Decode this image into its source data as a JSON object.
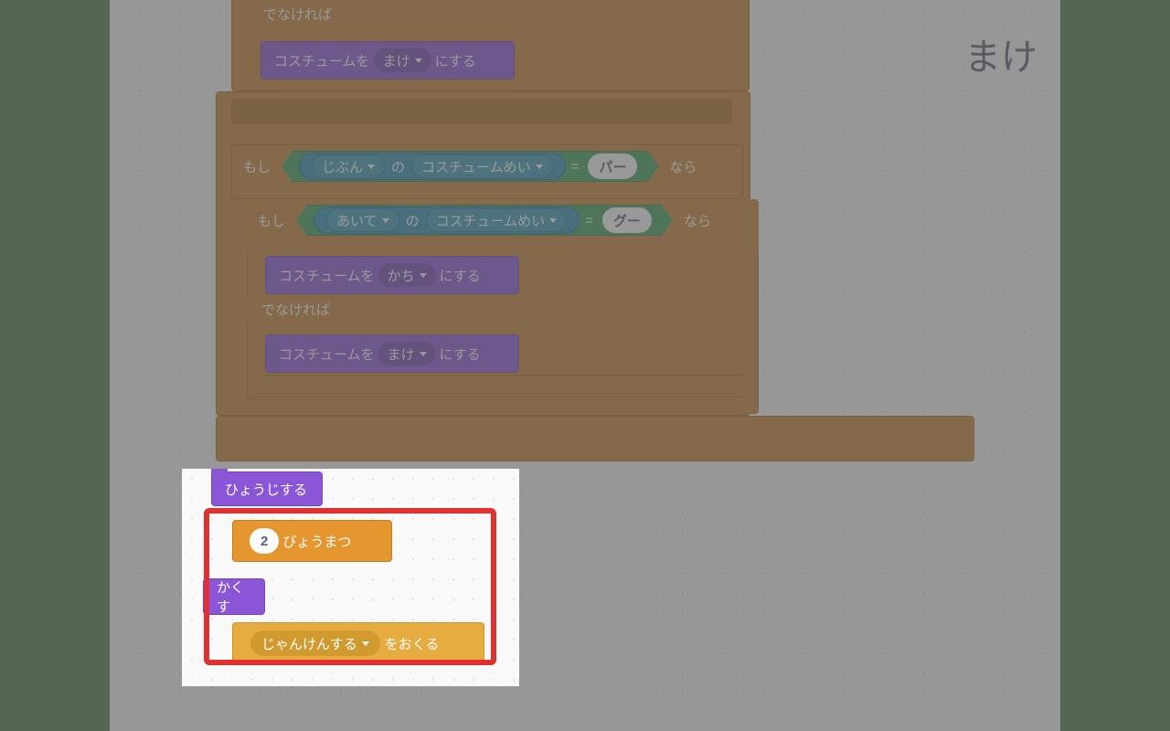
{
  "stage_label": "まけ",
  "else_label": "でなければ",
  "if_label": "もし",
  "then_label": "なら",
  "of_label": "の",
  "eq_label": "=",
  "costume_set_prefix": "コスチュームを",
  "costume_set_suffix": "にする",
  "dropdown": {
    "make": "まけ",
    "jibun": "じぶん",
    "costume_name": "コスチュームめい",
    "paa": "パー",
    "aite": "あいて",
    "guu": "グー",
    "kachi": "かち",
    "janken": "じゃんけんする"
  },
  "bottom": {
    "show": "ひょうじする",
    "wait_val": "2",
    "wait_suffix": "びょうまつ",
    "hide": "かくす",
    "broadcast_suffix": "をおくる"
  }
}
